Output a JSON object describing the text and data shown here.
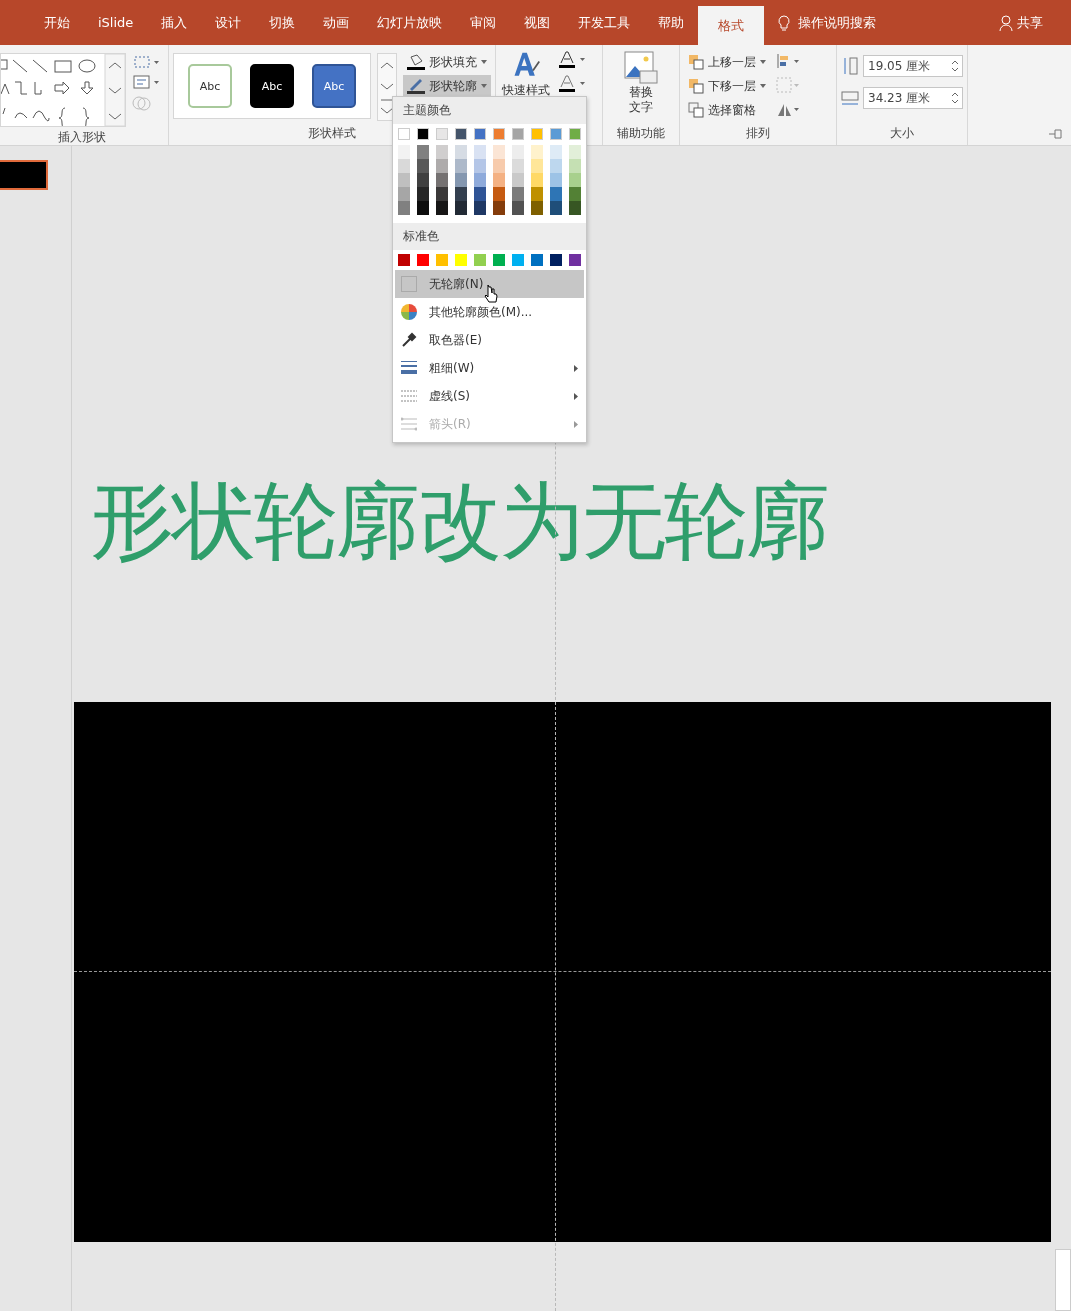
{
  "tabs": [
    {
      "label": "开始",
      "selected": false
    },
    {
      "label": "iSlide",
      "selected": false
    },
    {
      "label": "插入",
      "selected": false
    },
    {
      "label": "设计",
      "selected": false
    },
    {
      "label": "切换",
      "selected": false
    },
    {
      "label": "动画",
      "selected": false
    },
    {
      "label": "幻灯片放映",
      "selected": false
    },
    {
      "label": "审阅",
      "selected": false
    },
    {
      "label": "视图",
      "selected": false
    },
    {
      "label": "开发工具",
      "selected": false
    },
    {
      "label": "帮助",
      "selected": false
    },
    {
      "label": "格式",
      "selected": true
    }
  ],
  "tell_me": {
    "placeholder": "操作说明搜索"
  },
  "share": {
    "label": "共享"
  },
  "insert_shapes": {
    "label": "插入形状"
  },
  "shape_styles": {
    "label": "形状样式",
    "presets": [
      {
        "label": "Abc",
        "kind": "outline"
      },
      {
        "label": "Abc",
        "kind": "dark"
      },
      {
        "label": "Abc",
        "kind": "blue"
      }
    ],
    "commands": [
      {
        "label": "形状填充",
        "kind": "fill",
        "pressed": false
      },
      {
        "label": "形状轮廓",
        "kind": "outline",
        "pressed": true
      }
    ]
  },
  "wordart": {
    "quick_styles": "快速样式"
  },
  "accessibility": {
    "label": "辅助功能",
    "alt_text": [
      "替换",
      "文字"
    ]
  },
  "arrange": {
    "label": "排列",
    "commands": [
      {
        "label": "上移一层",
        "kind": "forward"
      },
      {
        "label": "下移一层",
        "kind": "backward"
      },
      {
        "label": "选择窗格",
        "kind": "pane"
      }
    ]
  },
  "size": {
    "label": "大小",
    "height": "19.05 厘米",
    "width": "34.23 厘米"
  },
  "outline_menu": {
    "theme_heading": "主题颜色",
    "theme_colors": [
      {
        "color": "#ffffff",
        "shades": [
          {
            "color": "#f2f2f2"
          },
          {
            "color": "#d9d9d9"
          },
          {
            "color": "#bfbfbf"
          },
          {
            "color": "#a6a6a6"
          },
          {
            "color": "#808080"
          }
        ]
      },
      {
        "color": "#000000",
        "shades": [
          {
            "color": "#808080"
          },
          {
            "color": "#595959"
          },
          {
            "color": "#404040"
          },
          {
            "color": "#262626"
          },
          {
            "color": "#0d0d0d"
          }
        ]
      },
      {
        "color": "#e7e6e6",
        "shades": [
          {
            "color": "#d0cece"
          },
          {
            "color": "#aeabab"
          },
          {
            "color": "#757171"
          },
          {
            "color": "#3a3838"
          },
          {
            "color": "#171616"
          }
        ]
      },
      {
        "color": "#44546a",
        "shades": [
          {
            "color": "#d6dce4"
          },
          {
            "color": "#adb9ca"
          },
          {
            "color": "#8497b0"
          },
          {
            "color": "#333f4f"
          },
          {
            "color": "#222a35"
          }
        ]
      },
      {
        "color": "#4472c4",
        "shades": [
          {
            "color": "#d9e2f3"
          },
          {
            "color": "#b4c6e7"
          },
          {
            "color": "#8eaadb"
          },
          {
            "color": "#2f5496"
          },
          {
            "color": "#1f3864"
          }
        ]
      },
      {
        "color": "#ed7d31",
        "shades": [
          {
            "color": "#fbe5d5"
          },
          {
            "color": "#f7cbac"
          },
          {
            "color": "#f4b183"
          },
          {
            "color": "#c55a11"
          },
          {
            "color": "#843c0b"
          }
        ]
      },
      {
        "color": "#a5a5a5",
        "shades": [
          {
            "color": "#ededed"
          },
          {
            "color": "#dbdbdb"
          },
          {
            "color": "#c9c9c9"
          },
          {
            "color": "#7b7b7b"
          },
          {
            "color": "#525252"
          }
        ]
      },
      {
        "color": "#ffc000",
        "shades": [
          {
            "color": "#fff2cc"
          },
          {
            "color": "#ffe699"
          },
          {
            "color": "#ffd966"
          },
          {
            "color": "#bf9000"
          },
          {
            "color": "#7f6000"
          }
        ]
      },
      {
        "color": "#5b9bd5",
        "shades": [
          {
            "color": "#deebf6"
          },
          {
            "color": "#bdd7ee"
          },
          {
            "color": "#9dc3e6"
          },
          {
            "color": "#2e75b5"
          },
          {
            "color": "#1f4e79"
          }
        ]
      },
      {
        "color": "#70ad47",
        "shades": [
          {
            "color": "#e2efd9"
          },
          {
            "color": "#c5e0b3"
          },
          {
            "color": "#a8d08d"
          },
          {
            "color": "#538135"
          },
          {
            "color": "#375623"
          }
        ]
      }
    ],
    "standard_heading": "标准色",
    "standard_colors": [
      {
        "color": "#c00000"
      },
      {
        "color": "#ff0000"
      },
      {
        "color": "#ffc000"
      },
      {
        "color": "#ffff00"
      },
      {
        "color": "#92d050"
      },
      {
        "color": "#00b050"
      },
      {
        "color": "#00b0f0"
      },
      {
        "color": "#0070c0"
      },
      {
        "color": "#002060"
      },
      {
        "color": "#7030a0"
      }
    ],
    "items": [
      {
        "label": "无轮廓(N)",
        "kind": "none",
        "selected": true,
        "disabled": false,
        "submenu": false
      },
      {
        "label": "其他轮廓颜色(M)...",
        "kind": "more",
        "selected": false,
        "disabled": false,
        "submenu": false
      },
      {
        "label": "取色器(E)",
        "kind": "eyedropper",
        "selected": false,
        "disabled": false,
        "submenu": false
      },
      {
        "label": "粗细(W)",
        "kind": "weight",
        "selected": false,
        "disabled": false,
        "submenu": true
      },
      {
        "label": "虚线(S)",
        "kind": "dashes",
        "selected": false,
        "disabled": false,
        "submenu": true
      },
      {
        "label": "箭头(R)",
        "kind": "arrows",
        "selected": false,
        "disabled": true,
        "submenu": true
      }
    ]
  },
  "thumbnails": [
    {
      "selected": true
    }
  ],
  "slide": {
    "title": "形状轮廓改为无轮廓"
  }
}
